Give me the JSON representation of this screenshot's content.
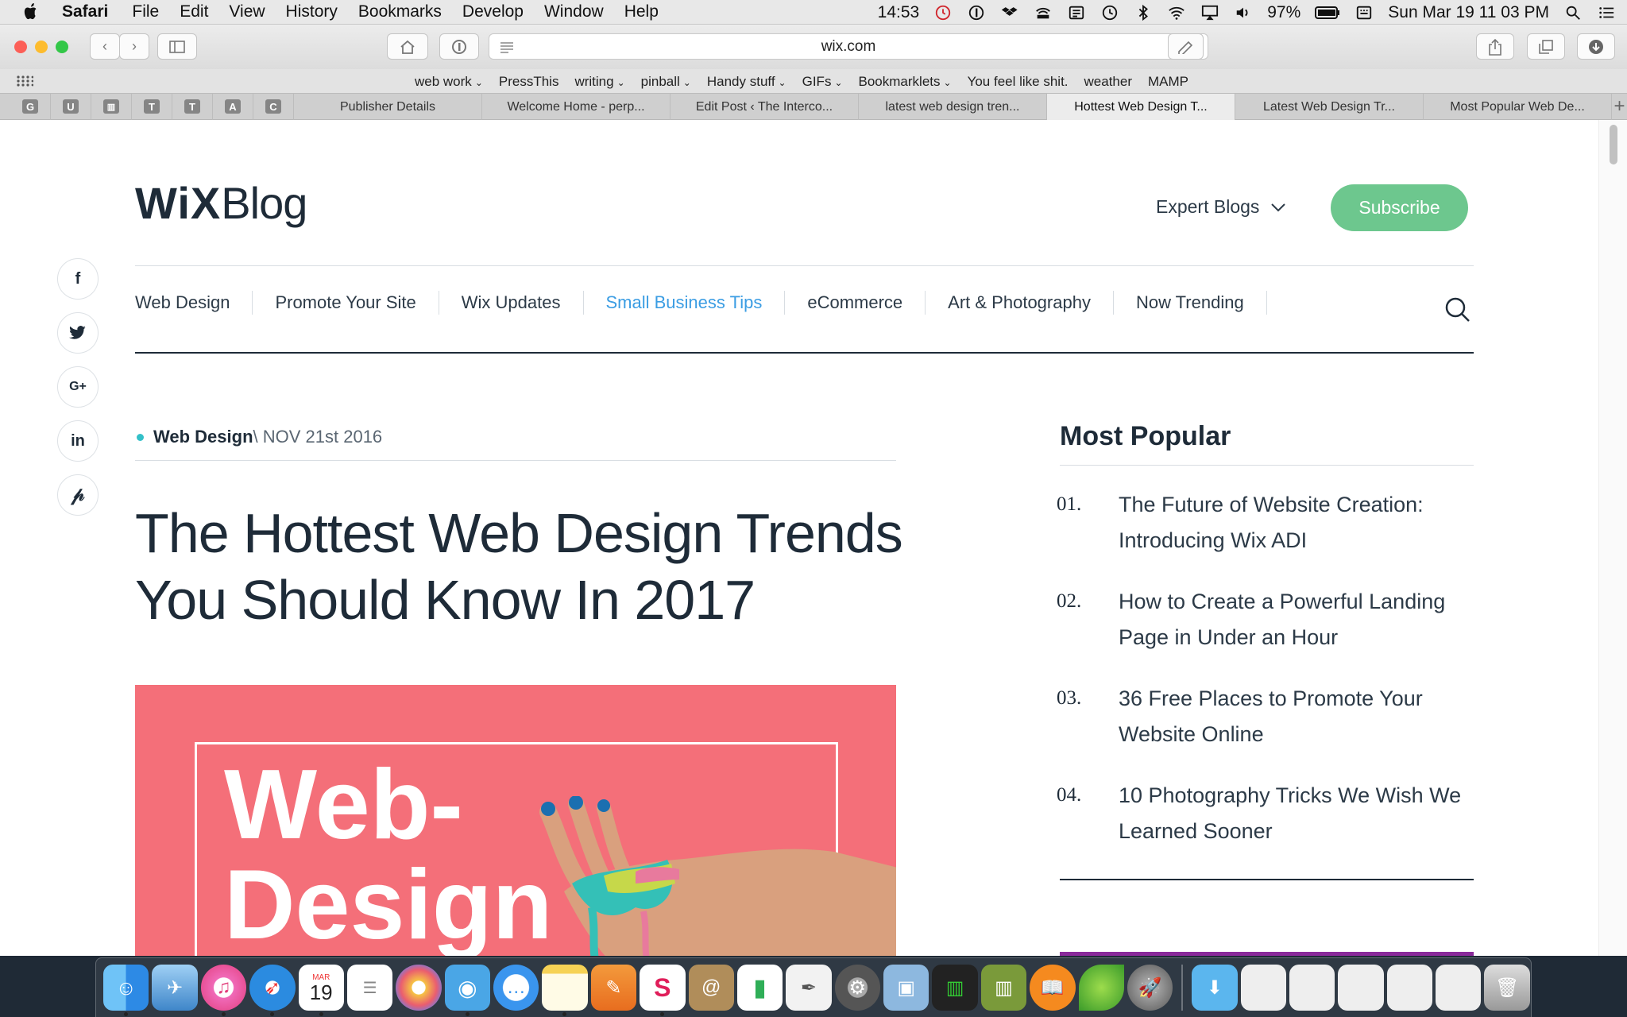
{
  "menubar": {
    "app_name": "Safari",
    "menus": [
      "File",
      "Edit",
      "View",
      "History",
      "Bookmarks",
      "Develop",
      "Window",
      "Help"
    ],
    "clock": "14:53",
    "battery": "97%",
    "datetime": "Sun Mar 19  11 03 PM"
  },
  "toolbar": {
    "url": "wix.com"
  },
  "bookmarks": [
    {
      "label": "web work",
      "folder": true
    },
    {
      "label": "PressThis",
      "folder": false
    },
    {
      "label": "writing",
      "folder": true
    },
    {
      "label": "pinball",
      "folder": true
    },
    {
      "label": "Handy stuff",
      "folder": true
    },
    {
      "label": "GIFs",
      "folder": true
    },
    {
      "label": "Bookmarklets",
      "folder": true
    },
    {
      "label": "You feel like shit.",
      "folder": false
    },
    {
      "label": "weather",
      "folder": false
    },
    {
      "label": "MAMP",
      "folder": false
    }
  ],
  "pinned_tabs": [
    "G",
    "U",
    "T",
    "T",
    "A",
    "C"
  ],
  "tabs": [
    {
      "title": "Publisher Details",
      "active": false
    },
    {
      "title": "Welcome Home - perp...",
      "active": false
    },
    {
      "title": "Edit Post ‹ The Interco...",
      "active": false
    },
    {
      "title": "latest web design tren...",
      "active": false
    },
    {
      "title": "Hottest Web Design T...",
      "active": true
    },
    {
      "title": "Latest Web Design Tr...",
      "active": false
    },
    {
      "title": "Most Popular Web De...",
      "active": false
    }
  ],
  "site": {
    "logo_wix": "WiX",
    "logo_blog": "Blog",
    "expert_blogs": "Expert Blogs",
    "subscribe": "Subscribe",
    "social": [
      "f",
      "t",
      "G+",
      "in",
      "p"
    ],
    "nav": [
      {
        "label": "Web Design",
        "highlight": false
      },
      {
        "label": "Promote Your Site",
        "highlight": false
      },
      {
        "label": "Wix Updates",
        "highlight": false
      },
      {
        "label": "Small Business Tips",
        "highlight": true
      },
      {
        "label": "eCommerce",
        "highlight": false
      },
      {
        "label": "Art & Photography",
        "highlight": false
      },
      {
        "label": "Now Trending",
        "highlight": false
      }
    ],
    "article": {
      "category": "Web Design",
      "date": " \\ NOV 21st 2016",
      "title": "The Hottest Web Design Trends You Should Know In 2017",
      "hero_text_line1": "Web-",
      "hero_text_line2": "Design"
    },
    "popular": {
      "title": "Most Popular",
      "items": [
        {
          "num": "01.",
          "text": "The Future of Website Creation: Introducing Wix ADI"
        },
        {
          "num": "02.",
          "text": "How to Create a Powerful Landing Page in Under an Hour"
        },
        {
          "num": "03.",
          "text": "36 Free Places to Promote Your Website Online"
        },
        {
          "num": "04.",
          "text": "10 Photography Tricks We Wish We Learned Sooner"
        }
      ]
    },
    "colors": {
      "accent_nav": "#3b9de3",
      "subscribe": "#6dc78e",
      "hero": "#f46f79",
      "dark": "#1e2b38"
    }
  },
  "dock": {
    "apps": [
      "finder-icon",
      "mail-icon",
      "itunes-icon",
      "safari-icon",
      "calendar-icon",
      "reminders-icon",
      "photos-icon",
      "tweetbot-icon",
      "messages-icon",
      "notes-icon",
      "pages-icon",
      "slack-icon",
      "contacts-icon",
      "numbers-icon",
      "textedit-icon",
      "system-preferences-icon",
      "preview-icon",
      "activity-monitor-icon",
      "books-shelf-icon",
      "ibooks-icon",
      "evernote-icon",
      "launchpad-icon"
    ],
    "calendar_month": "MAR",
    "calendar_day": "19"
  }
}
